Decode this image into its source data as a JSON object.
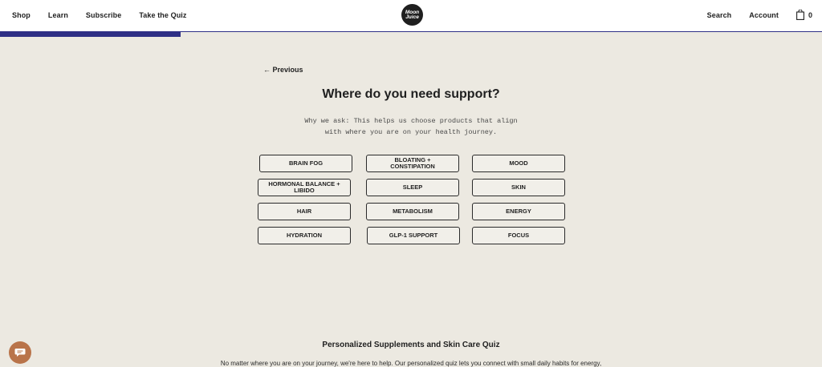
{
  "header": {
    "nav_left": [
      "Shop",
      "Learn",
      "Subscribe",
      "Take the Quiz"
    ],
    "logo_line1": "Moon",
    "logo_line2": "Juice",
    "search_label": "Search",
    "account_label": "Account",
    "cart_count": "0"
  },
  "progress": {
    "fraction": 0.22,
    "color": "#2e2f85"
  },
  "quiz": {
    "previous_label": "← Previous",
    "title": "Where do you need support?",
    "subtitle_line1": "Why we ask: This helps us choose products that align",
    "subtitle_line2": "with where you are on your health journey.",
    "options": [
      [
        "BRAIN FOG",
        "BLOATING + CONSTIPATION",
        "MOOD"
      ],
      [
        "HORMONAL BALANCE + LIBIDO",
        "SLEEP",
        "SKIN"
      ],
      [
        "HAIR",
        "METABOLISM",
        "ENERGY"
      ],
      [
        "HYDRATION",
        "GLP-1 SUPPORT",
        "FOCUS"
      ]
    ]
  },
  "footer": {
    "title": "Personalized Supplements and Skin Care Quiz",
    "text": "No matter where you are on your journey, we're here to help. Our personalized quiz lets you connect with small daily habits for energy,"
  },
  "chat": {
    "icon": "chat-icon",
    "color": "#b9744a"
  }
}
